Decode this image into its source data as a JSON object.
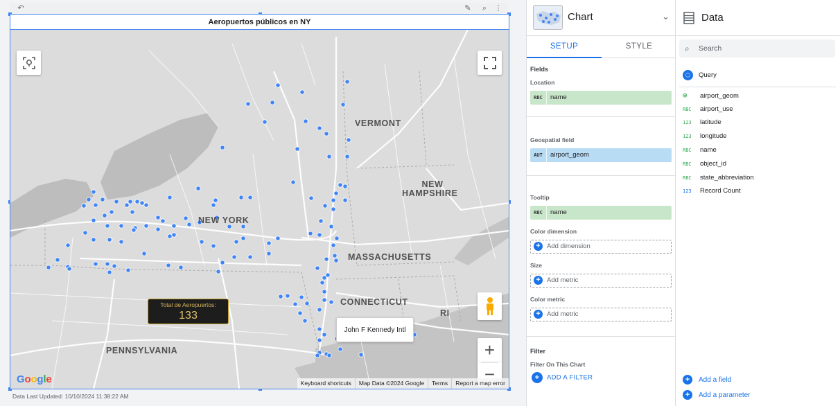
{
  "canvas": {
    "chart_title": "Aeropuertos públicos en NY",
    "data_last_updated": "Data Last Updated: 10/10/2024 11:38:22 AM",
    "scorecard": {
      "label": "Total de Aeropuertos:",
      "value": "133"
    },
    "tooltip": "John F Kennedy Intl",
    "map_labels": {
      "vermont": "VERMONT",
      "new_hampshire_1": "NEW",
      "new_hampshire_2": "HAMPSHIRE",
      "new_york": "NEW YORK",
      "massachusetts": "MASSACHUSETTS",
      "connecticut": "CONNECTICUT",
      "ri": "RI",
      "pennsylvania": "PENNSYLVANIA"
    },
    "google_logo": "Google",
    "footer": {
      "shortcuts": "Keyboard shortcuts",
      "map_data": "Map Data ©2024 Google",
      "terms": "Terms",
      "report": "Report a map error"
    },
    "zoom_in": "+",
    "zoom_out": "−",
    "colors": {
      "point": "#4285f4",
      "accent": "#1a73e8",
      "selection": "#4285f4"
    }
  },
  "chart_panel": {
    "type_label": "Chart",
    "tabs": {
      "setup": "SETUP",
      "style": "STYLE"
    },
    "fields_title": "Fields",
    "location_label": "Location",
    "location_chip": {
      "type": "RBC",
      "name": "name"
    },
    "geospatial_label": "Geospatial field",
    "geospatial_chip": {
      "type": "AUT",
      "name": "airport_geom"
    },
    "tooltip_label": "Tooltip",
    "tooltip_chip": {
      "type": "RBC",
      "name": "name"
    },
    "color_dimension_label": "Color dimension",
    "add_dimension": "Add dimension",
    "size_label": "Size",
    "add_metric_size": "Add metric",
    "color_metric_label": "Color metric",
    "add_metric_color": "Add metric",
    "filter_title": "Filter",
    "filter_on_chart": "Filter On This Chart",
    "add_filter": "ADD A FILTER"
  },
  "data_panel": {
    "title": "Data",
    "search_placeholder": "Search",
    "query_label": "Query",
    "fields": [
      {
        "type": "geo",
        "name": "airport_geom"
      },
      {
        "type": "RBC",
        "name": "airport_use"
      },
      {
        "type": "123",
        "name": "latitude"
      },
      {
        "type": "123",
        "name": "longitude"
      },
      {
        "type": "RBC",
        "name": "name"
      },
      {
        "type": "RBC",
        "name": "object_id"
      },
      {
        "type": "RBC",
        "name": "state_abbreviation"
      },
      {
        "type": "123",
        "name": "Record Count"
      }
    ],
    "add_field": "Add a field",
    "add_parameter": "Add a parameter"
  }
}
